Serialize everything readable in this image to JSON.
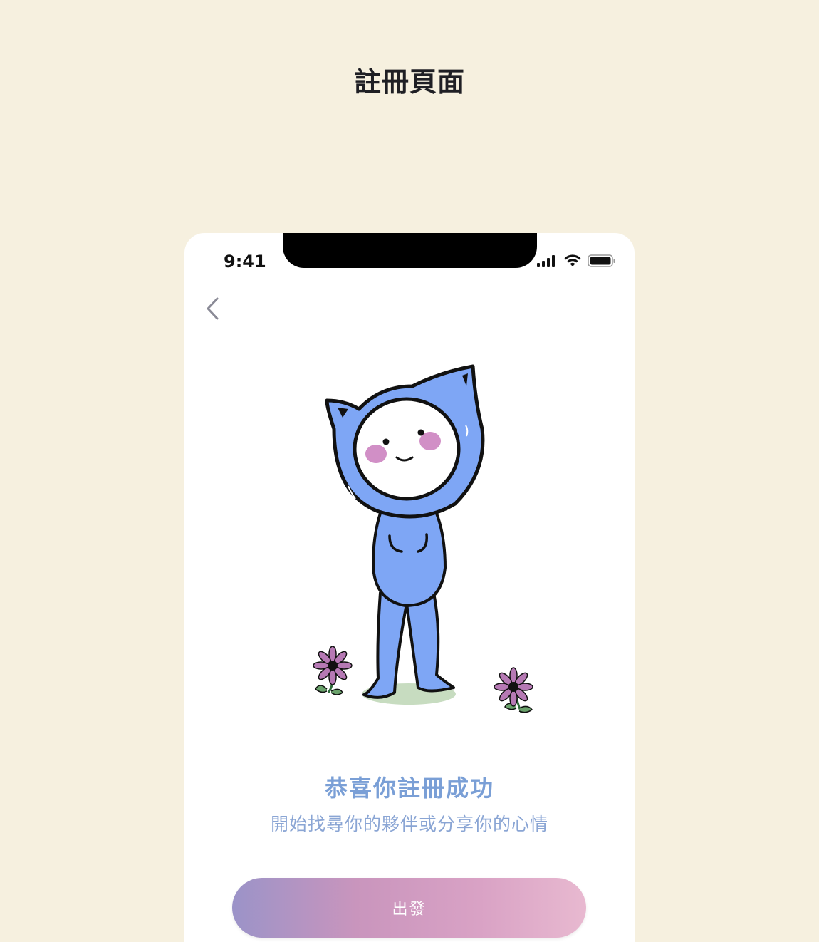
{
  "page": {
    "title": "註冊頁面"
  },
  "status_bar": {
    "time": "9:41",
    "icons": [
      "signal-icon",
      "wifi-icon",
      "battery-icon"
    ]
  },
  "nav": {
    "back_icon": "chevron-left-icon"
  },
  "illustration": {
    "description_icon": "blue-cat-character-illustration"
  },
  "content": {
    "headline": "恭喜你註冊成功",
    "subline": "開始找尋你的夥伴或分享你的心情"
  },
  "actions": {
    "start_label": "出發"
  },
  "colors": {
    "background": "#f6f0df",
    "headline": "#7a9fd6",
    "subline": "#8aa5d4",
    "button_gradient_start": "#9b93c8",
    "button_gradient_end": "#e8b9d0",
    "character_body": "#7ea6f5",
    "cheek": "#d18fc6",
    "flower": "#b679b4"
  }
}
